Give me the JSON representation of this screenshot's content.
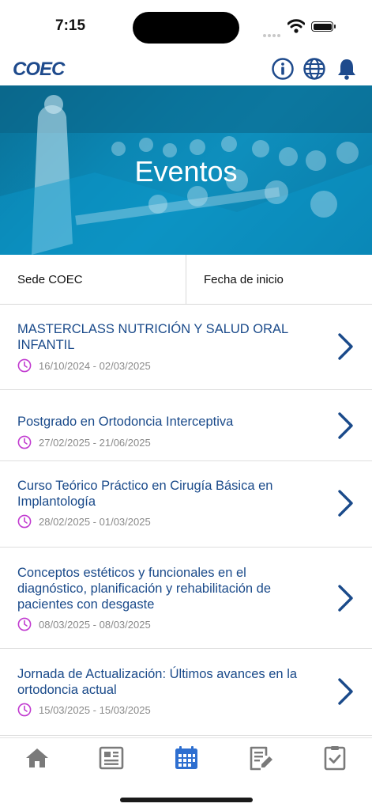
{
  "status_bar": {
    "time": "7:15"
  },
  "header": {
    "logo": "COEC"
  },
  "hero": {
    "title": "Eventos"
  },
  "filters": [
    {
      "label": "Sede COEC"
    },
    {
      "label": "Fecha de inicio"
    }
  ],
  "events": [
    {
      "title": "MASTERCLASS NUTRICIÓN Y SALUD ORAL INFANTIL",
      "dates": "16/10/2024 - 02/03/2025"
    },
    {
      "title": "Postgrado en Ortodoncia Interceptiva",
      "dates": "27/02/2025 - 21/06/2025"
    },
    {
      "title": "Curso Teórico Práctico en Cirugía Básica en Implantología",
      "dates": "28/02/2025 - 01/03/2025"
    },
    {
      "title": "Conceptos estéticos y funcionales en el diagnóstico, planificación y rehabilitación de pacientes con desgaste",
      "dates": "08/03/2025 - 08/03/2025"
    },
    {
      "title": "Jornada de Actualización: Últimos avances en la ortodoncia actual",
      "dates": "15/03/2025 - 15/03/2025"
    }
  ],
  "tabbar": {
    "tabs": [
      {
        "icon": "home-icon",
        "active": false
      },
      {
        "icon": "news-icon",
        "active": false
      },
      {
        "icon": "calendar-icon",
        "active": true
      },
      {
        "icon": "form-edit-icon",
        "active": false
      },
      {
        "icon": "checklist-icon",
        "active": false
      }
    ],
    "active_color": "#2e6fd0",
    "inactive_color": "#7a7a7a"
  },
  "colors": {
    "brand": "#1e4a8c",
    "title_text": "#1a4a8a",
    "date_icon": "#c13bd0",
    "hero": "#0b87b4"
  }
}
